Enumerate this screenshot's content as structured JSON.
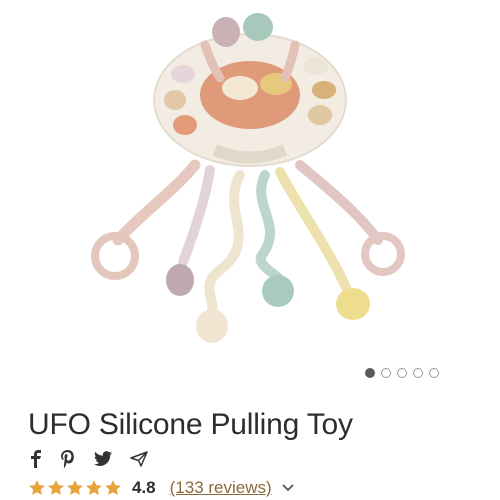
{
  "product": {
    "title": "UFO Silicone Pulling Toy",
    "image_label": "product-photo-ufo-toy"
  },
  "carousel": {
    "total": 5,
    "active_index": 0
  },
  "share": {
    "icons": [
      "facebook-icon",
      "pinterest-icon",
      "twitter-icon",
      "send-icon"
    ]
  },
  "rating": {
    "stars": 5,
    "value": "4.8",
    "reviews_text": "(133 reviews)",
    "star_color": "#e8a33d"
  }
}
